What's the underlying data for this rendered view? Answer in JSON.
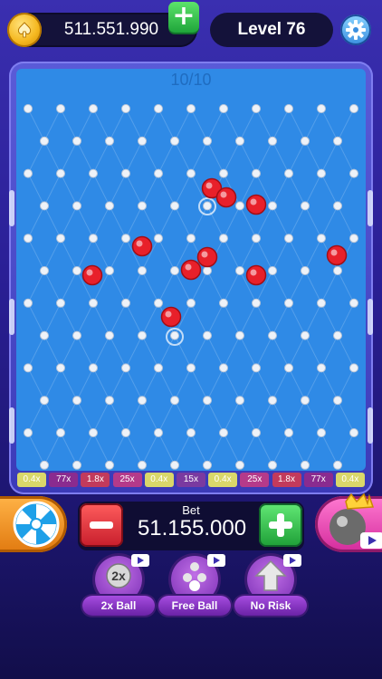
{
  "header": {
    "coins": "511.551.990",
    "level": "Level 76"
  },
  "board": {
    "counter": "10/10",
    "multipliers": [
      "0.4x",
      "77x",
      "1.8x",
      "25x",
      "0.4x",
      "15x",
      "0.4x",
      "25x",
      "1.8x",
      "77x",
      "0.4x"
    ],
    "slot_colors": [
      "#d9d76a",
      "#8a2b8f",
      "#c23a5c",
      "#b53a8a",
      "#d9d76a",
      "#7a3aa0",
      "#d9d76a",
      "#b53a8a",
      "#c23a5c",
      "#8a2b8f",
      "#d9d76a"
    ]
  },
  "bet": {
    "label": "Bet",
    "value": "51.155.000"
  },
  "powerups": [
    {
      "label": "2x Ball",
      "icon": "2x-ball-icon"
    },
    {
      "label": "Free Ball",
      "icon": "free-ball-icon"
    },
    {
      "label": "No Risk",
      "icon": "no-risk-arrow-icon"
    }
  ],
  "colors": {
    "board": "#2f8ae6",
    "ball": "#e8202a",
    "accent_green": "#1fa53a",
    "accent_red": "#c71d2b"
  }
}
